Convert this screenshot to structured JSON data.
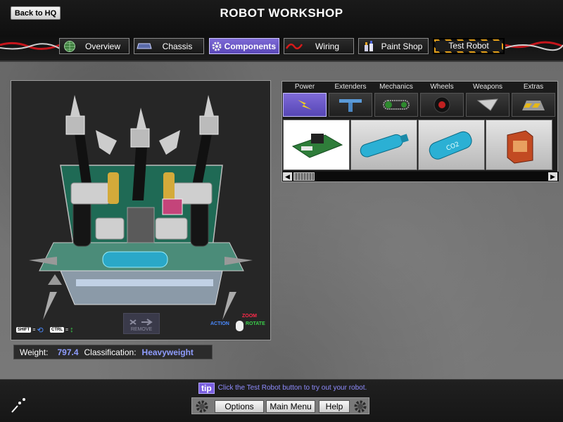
{
  "header": {
    "back_label": "Back to HQ",
    "title": "ROBOT WORKSHOP"
  },
  "tabs": [
    {
      "label": "Overview",
      "icon": "globe-icon"
    },
    {
      "label": "Chassis",
      "icon": "chassis-icon"
    },
    {
      "label": "Components",
      "icon": "gear-icon",
      "active": true
    },
    {
      "label": "Wiring",
      "icon": "wire-icon"
    },
    {
      "label": "Paint Shop",
      "icon": "paint-icon"
    },
    {
      "label": "Test Robot",
      "icon": "",
      "style": "hazard"
    }
  ],
  "viewport": {
    "shift_key": "SHIFT",
    "ctrl_key": "CTRL",
    "remove_label": "REMOVE",
    "mouse_hint": {
      "zoom": "ZOOM",
      "action": "ACTION",
      "rotate": "ROTATE"
    }
  },
  "stats": {
    "weight_label": "Weight:",
    "weight_value": "797.4",
    "class_label": "Classification:",
    "class_value": "Heavyweight"
  },
  "categories": [
    {
      "label": "Power",
      "icon": "lightning-icon",
      "active": true
    },
    {
      "label": "Extenders",
      "icon": "extender-icon"
    },
    {
      "label": "Mechanics",
      "icon": "chain-icon"
    },
    {
      "label": "Wheels",
      "icon": "wheel-icon"
    },
    {
      "label": "Weapons",
      "icon": "blade-icon"
    },
    {
      "label": "Extras",
      "icon": "wedge-icon"
    }
  ],
  "parts": [
    {
      "name": "circuit-board-part",
      "selected": true
    },
    {
      "name": "blue-tank-part"
    },
    {
      "name": "co2-tank-part",
      "label": "CO2"
    },
    {
      "name": "battery-box-part"
    }
  ],
  "footer": {
    "tip_badge": "tip",
    "tip_text": "Click the Test Robot button to try out your robot.",
    "options_label": "Options",
    "main_menu_label": "Main Menu",
    "help_label": "Help"
  },
  "colors": {
    "accent": "#6a56c8",
    "value_text": "#8f9dff",
    "tip_text": "#8f8cff"
  }
}
